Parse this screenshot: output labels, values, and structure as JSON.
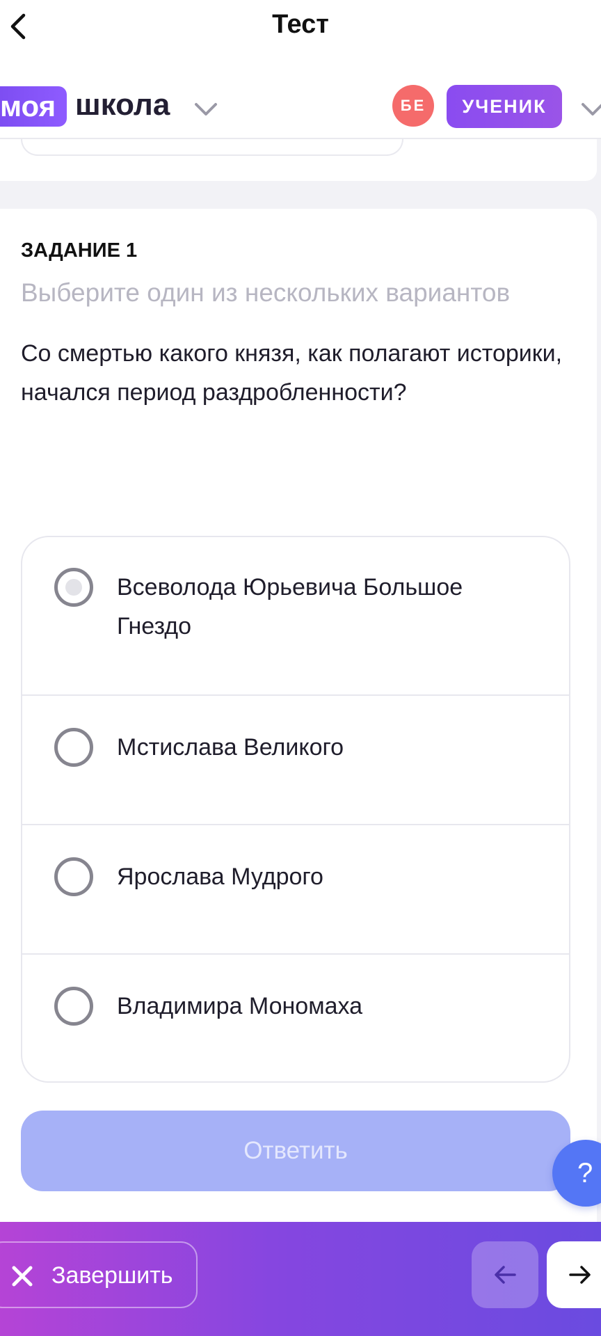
{
  "nav": {
    "title": "Тест"
  },
  "header": {
    "logo_badge": "моя",
    "logo_word": "школа",
    "avatar_initials": "БЕ",
    "role_label": "УЧЕНИК"
  },
  "task": {
    "label": "ЗАДАНИЕ 1",
    "hint": "Выберите один из нескольких вариантов",
    "question": "Со смертью какого князя, как полагают историки, начался период раздробленности?",
    "options": [
      {
        "label": "Всеволода Юрьевича Большое Гнездо",
        "pressed": true
      },
      {
        "label": "Мстислава Великого",
        "pressed": false
      },
      {
        "label": "Ярослава Мудрого",
        "pressed": false
      },
      {
        "label": "Владимира Мономаха",
        "pressed": false
      }
    ],
    "answer_label": "Ответить",
    "help_label": "?"
  },
  "footer": {
    "finish_label": "Завершить"
  },
  "colors": {
    "brand_purple": "#8a4cf0",
    "avatar_red": "#f56b6b",
    "answer_disabled": "#a6b1f7",
    "help_blue": "#5476f5"
  },
  "icons": {
    "back": "chevron-left-icon",
    "dropdown": "chevron-down-icon",
    "finish": "close-icon",
    "prev": "arrow-left-icon",
    "next": "arrow-right-icon"
  }
}
